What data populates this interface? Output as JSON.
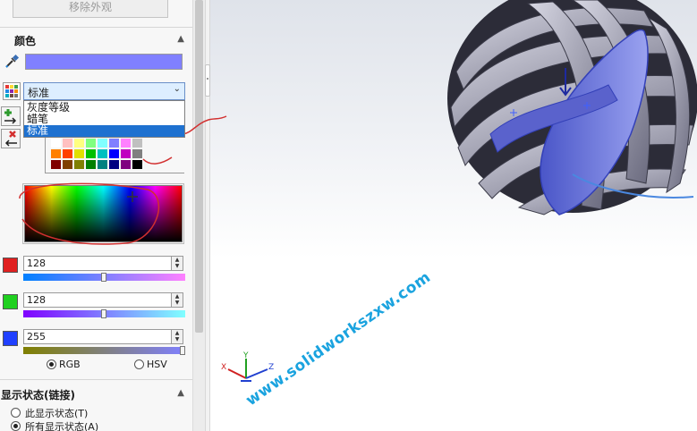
{
  "appearance_panel": {
    "remove_appearance_label": "移除外观",
    "color_section": {
      "title": "颜色",
      "current_color": "#8080ff",
      "palette_select": {
        "selected": "标准",
        "options": [
          "灰度等级",
          "蜡笔",
          "标准"
        ],
        "highlighted_option": "标准"
      },
      "swatches": [
        "#ffffff",
        "#ffc0c0",
        "#ffff80",
        "#80ff80",
        "#80ffff",
        "#8080ff",
        "#ff80ff",
        "#c0c0c0",
        "#ff8000",
        "#ff4000",
        "#e0e000",
        "#00c000",
        "#00c0c0",
        "#0000ff",
        "#c000c0",
        "#808080",
        "#800000",
        "#804000",
        "#808000",
        "#008000",
        "#008080",
        "#000080",
        "#800080",
        "#000000"
      ],
      "red": {
        "value": "128",
        "swatch_color": "#e02020"
      },
      "green": {
        "value": "128",
        "swatch_color": "#20d020"
      },
      "blue": {
        "value": "255",
        "swatch_color": "#2040ff"
      },
      "mode_rgb": "RGB",
      "mode_hsv": "HSV"
    },
    "display_state_section": {
      "title": "显示状态(链接)",
      "option_this": "此显示状态(T)",
      "option_all": "所有显示状态(A)"
    }
  },
  "viewport": {
    "watermark": "www.solidworkszxw.com",
    "triad": {
      "x": "X",
      "y": "Y",
      "z": "Z"
    }
  }
}
